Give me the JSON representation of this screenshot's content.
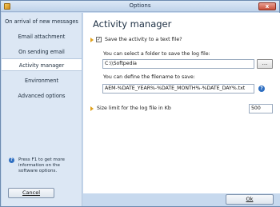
{
  "window": {
    "title": "Options",
    "close_label": "x"
  },
  "sidebar": {
    "items": [
      {
        "label": "On arrival of new messages"
      },
      {
        "label": "Email attachment"
      },
      {
        "label": "On sending email"
      },
      {
        "label": "Activity manager",
        "active": true
      },
      {
        "label": "Environment"
      },
      {
        "label": "Advanced options"
      }
    ],
    "help_icon": "?",
    "help_text": "Press F1 to get more information on the software options."
  },
  "buttons": {
    "cancel_label": "Cancel",
    "ok_label": "Ok"
  },
  "main": {
    "heading": "Activity manager",
    "save_checkbox_label": "Save the activity to a text file?",
    "save_checked": true,
    "folder_label": "You can select a folder to save the log file:",
    "folder_value": "C:\\\\Softpedia",
    "browse_label": "...",
    "filename_label": "You can define the filename to save:",
    "filename_value": "AEM-%DATE_YEAR%-%DATE_MONTH%-%DATE_DAY%.txt",
    "filename_help": "?",
    "size_limit_label": "Size limit for the log file in Kb",
    "size_limit_value": "500"
  },
  "icons": {
    "app": "app-icon",
    "arrow": "orange-arrow-icon",
    "help": "help-icon"
  },
  "colors": {
    "accent_arrow": "#e0a11b",
    "help_blue": "#2f6fc1",
    "sidebar_bg": "#dce7f4"
  }
}
